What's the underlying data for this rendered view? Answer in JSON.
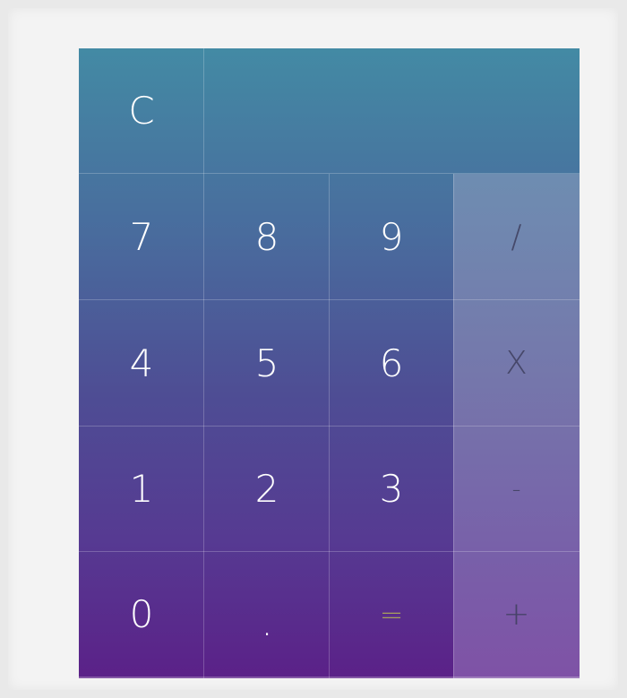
{
  "calculator": {
    "display_value": "",
    "clear_label": "C",
    "keys": {
      "seven": "7",
      "eight": "8",
      "nine": "9",
      "divide": "/",
      "four": "4",
      "five": "5",
      "six": "6",
      "multiply": "X",
      "one": "1",
      "two": "2",
      "three": "3",
      "subtract": "-",
      "zero": "0",
      "decimal": ".",
      "equals": "=",
      "add": "+"
    }
  }
}
